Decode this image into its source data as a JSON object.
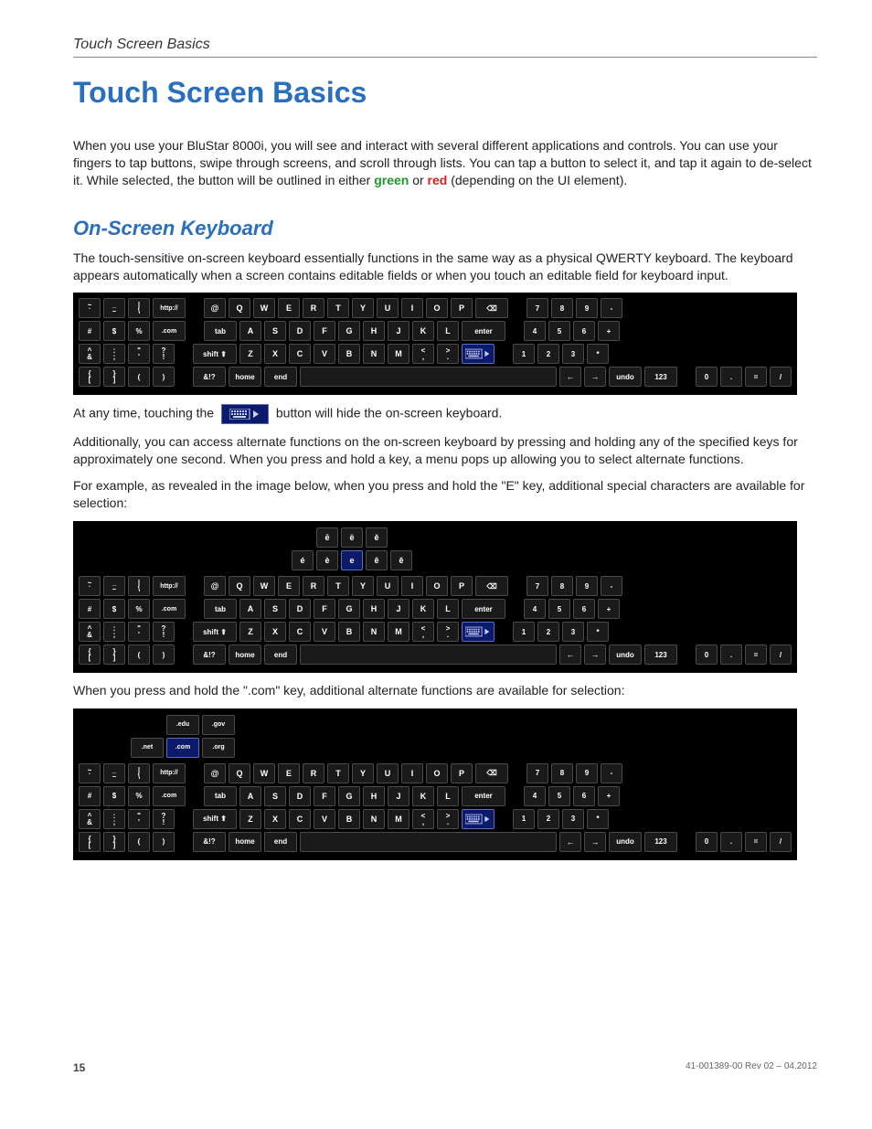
{
  "header": {
    "running": "Touch Screen Basics"
  },
  "title": "Touch Screen Basics",
  "intro": {
    "part1": "When you use your BluStar 8000i, you will see and interact with several different applications and controls. You can use your fingers to tap buttons, swipe through screens, and scroll through lists. You can tap a button to select it, and tap it again to de-select it. While selected, the button will be outlined in either ",
    "green": "green",
    "or": " or ",
    "red": "red",
    "part2": " (depending on the UI element)."
  },
  "section": {
    "title": "On-Screen Keyboard"
  },
  "para_osk": "The touch-sensitive on-screen keyboard essentially functions in the same way as a physical QWERTY keyboard. The keyboard appears automatically when a screen contains editable fields or when you touch an editable field for keyboard input.",
  "hide_para": {
    "pre": "At any time, touching the ",
    "post": " button will hide the on-screen keyboard."
  },
  "para_alt": "Additionally, you can access alternate functions on the on-screen keyboard by pressing and holding any of the specified keys for approximately one second. When you press and hold a key, a menu pops up allowing you to select alternate functions.",
  "para_e": "For example, as revealed in the image below, when you press and hold the \"E\" key, additional special characters are available for selection:",
  "para_com": "When you press and hold the \".com\" key, additional alternate functions are available for selection:",
  "kb": {
    "sym_row1": [
      "~\n`",
      "_\n–",
      "|\n\\",
      "http://"
    ],
    "sym_row2": [
      "#",
      "$",
      "%",
      ".com"
    ],
    "sym_row3": [
      "^\n&",
      ":\n;",
      "\"\n'",
      "?\n!"
    ],
    "sym_row4": [
      "{\n[",
      "}\n]",
      "(",
      ")"
    ],
    "q_row1": [
      "@",
      "Q",
      "W",
      "E",
      "R",
      "T",
      "Y",
      "U",
      "I",
      "O",
      "P",
      "⌫"
    ],
    "q_row2_lead": "tab",
    "q_row2": [
      "A",
      "S",
      "D",
      "F",
      "G",
      "H",
      "J",
      "K",
      "L"
    ],
    "q_row2_end": "enter",
    "q_row3_lead": "shift ⬆",
    "q_row3": [
      "Z",
      "X",
      "C",
      "V",
      "B",
      "N",
      "M"
    ],
    "q_row3_punct": [
      "<\n,",
      ">\n."
    ],
    "q_row4_lead": "&!?",
    "q_row4_a": [
      "home",
      "end"
    ],
    "q_row4_b": [
      "←",
      "→",
      "undo",
      "123"
    ],
    "num": {
      "r1": [
        "7",
        "8",
        "9",
        "-"
      ],
      "r2": [
        "4",
        "5",
        "6",
        "+"
      ],
      "r3": [
        "1",
        "2",
        "3",
        "*"
      ],
      "r4": [
        "0",
        ".",
        "=",
        "/"
      ]
    }
  },
  "popup_e": {
    "top": [
      "ē",
      "ë",
      "ě"
    ],
    "bot": [
      "é",
      "è",
      "e",
      "ê",
      "ĕ"
    ]
  },
  "popup_com": {
    "top": [
      ".edu",
      ".gov"
    ],
    "bot": [
      ".net",
      ".com",
      ".org"
    ]
  },
  "footer": {
    "page": "15",
    "rev": "41-001389-00 Rev 02 – 04.2012"
  }
}
